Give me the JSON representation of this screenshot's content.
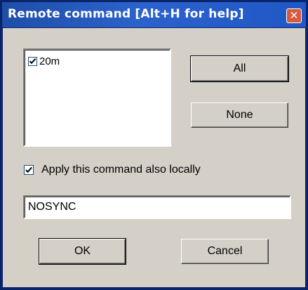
{
  "window": {
    "title": "Remote command [Alt+H for help]",
    "close_symbol": "✕"
  },
  "colors": {
    "titlebar": "#2c62cc",
    "face": "#d4d0c8",
    "close": "#d85a3c",
    "frame": "#0a246a"
  },
  "bands": {
    "items": [
      {
        "label": "20m",
        "checked": true
      }
    ]
  },
  "buttons": {
    "all_label": "All",
    "none_label": "None",
    "ok_label": "OK",
    "cancel_label": "Cancel"
  },
  "apply_local": {
    "label": "Apply this command also locally",
    "checked": true
  },
  "command": {
    "value": "NOSYNC"
  }
}
